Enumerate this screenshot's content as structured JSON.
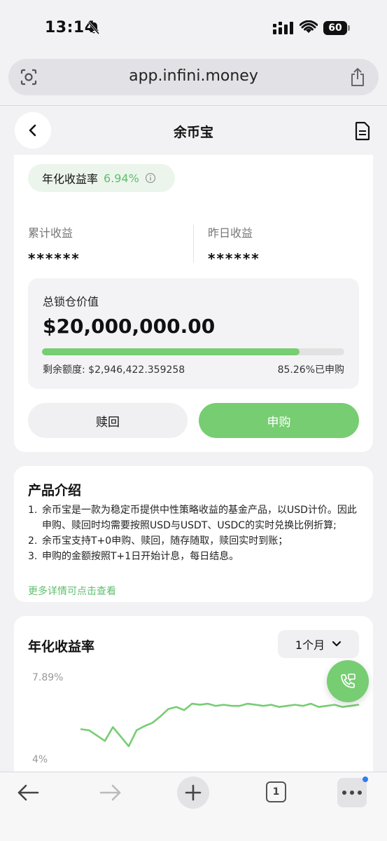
{
  "status_bar": {
    "time": "13:14",
    "battery": "60"
  },
  "browser": {
    "url": "app.infini.money"
  },
  "header": {
    "title": "余币宝"
  },
  "apy": {
    "label": "年化收益率",
    "value": "6.94%"
  },
  "stats": {
    "cumulative_label": "累计收益",
    "cumulative_value": "******",
    "yesterday_label": "昨日收益",
    "yesterday_value": "******"
  },
  "tvl": {
    "label": "总锁仓价值",
    "value": "$20,000,000.00",
    "remaining": "剩余额度: $2,946,422.359258",
    "subscribed_text": "85.26%已申购",
    "subscribed_fraction": 0.8526
  },
  "actions": {
    "redeem": "赎回",
    "subscribe": "申购"
  },
  "intro": {
    "title": "产品介绍",
    "items": [
      {
        "num": "1.",
        "text": "余币宝是一款为稳定币提供中性策略收益的基金产品，以USD计价。因此申购、赎回时均需要按照USD与USDT、USDC的实时兑换比例折算;"
      },
      {
        "num": "2.",
        "text": "余币宝支持T+0申购、赎回，随存随取，赎回实时到账；"
      },
      {
        "num": "3.",
        "text": "申购的金额按照T+1日开始计息，每日结息。"
      }
    ],
    "more_link": "更多详情可点击查看"
  },
  "chart_section": {
    "title": "年化收益率",
    "range": "1个月"
  },
  "chart_data": {
    "type": "line",
    "title": "年化收益率",
    "ylim": [
      4,
      7.89
    ],
    "y_tick_labels": [
      "7.89%",
      "4%"
    ],
    "grid": false,
    "series": [
      {
        "color": "#77cd72",
        "values": [
          5.4,
          5.35,
          5.1,
          4.85,
          5.5,
          5.05,
          4.6,
          5.35,
          5.55,
          5.7,
          6.0,
          6.35,
          6.45,
          6.3,
          6.6,
          6.55,
          6.6,
          6.5,
          6.55,
          6.5,
          6.5,
          6.6,
          6.55,
          6.5,
          6.55,
          6.45,
          6.5,
          6.55,
          6.5,
          6.6,
          6.45,
          6.5,
          6.55,
          6.45,
          6.5,
          6.55
        ]
      }
    ]
  },
  "toolbar": {
    "tabs_count": "1"
  }
}
